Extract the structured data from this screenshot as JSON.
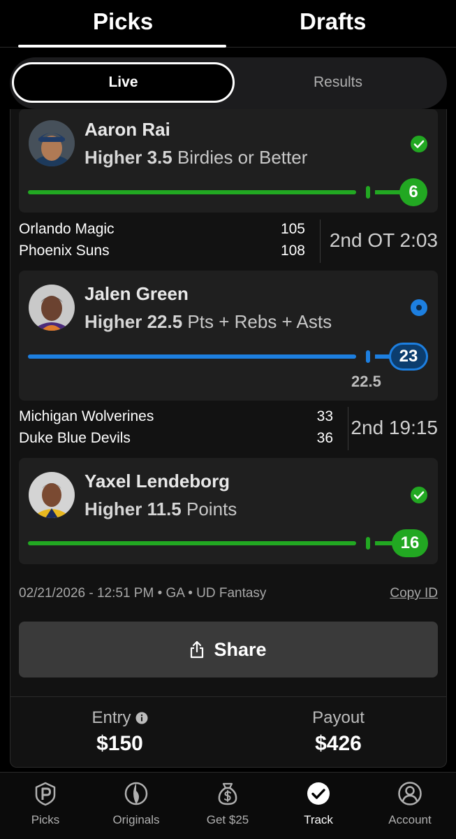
{
  "top_tabs": {
    "picks": "Picks",
    "drafts": "Drafts"
  },
  "segmented": {
    "live": "Live",
    "results": "Results"
  },
  "colors": {
    "green": "#22a822",
    "blue": "#1d7fe0"
  },
  "picks": [
    {
      "player": "Aaron Rai",
      "direction": "Higher",
      "line": "3.5",
      "stat": "Birdies or Better",
      "current": "6",
      "status": "hit"
    },
    {
      "player": "Jalen Green",
      "direction": "Higher",
      "line": "22.5",
      "stat": "Pts + Rebs + Asts",
      "current": "23",
      "target_label": "22.5",
      "status": "live"
    },
    {
      "player": "Yaxel Lendeborg",
      "direction": "Higher",
      "line": "11.5",
      "stat": "Points",
      "current": "16",
      "status": "hit"
    }
  ],
  "games": [
    {
      "team1": "Orlando Magic",
      "score1": "105",
      "team2": "Phoenix Suns",
      "score2": "108",
      "clock": "2nd OT 2:03"
    },
    {
      "team1": "Michigan Wolverines",
      "score1": "33",
      "team2": "Duke Blue Devils",
      "score2": "36",
      "clock": "2nd 19:15"
    }
  ],
  "meta": {
    "text": "02/21/2026 - 12:51 PM • GA • UD Fantasy",
    "copy_id": "Copy ID"
  },
  "share": {
    "label": "Share"
  },
  "totals": {
    "entry_label": "Entry",
    "entry_value": "$150",
    "payout_label": "Payout",
    "payout_value": "$426"
  },
  "nav": [
    {
      "label": "Picks",
      "icon": "picks-icon"
    },
    {
      "label": "Originals",
      "icon": "originals-icon"
    },
    {
      "label": "Get $25",
      "icon": "money-bag-icon"
    },
    {
      "label": "Track",
      "icon": "check-circle-icon"
    },
    {
      "label": "Account",
      "icon": "account-icon"
    }
  ]
}
